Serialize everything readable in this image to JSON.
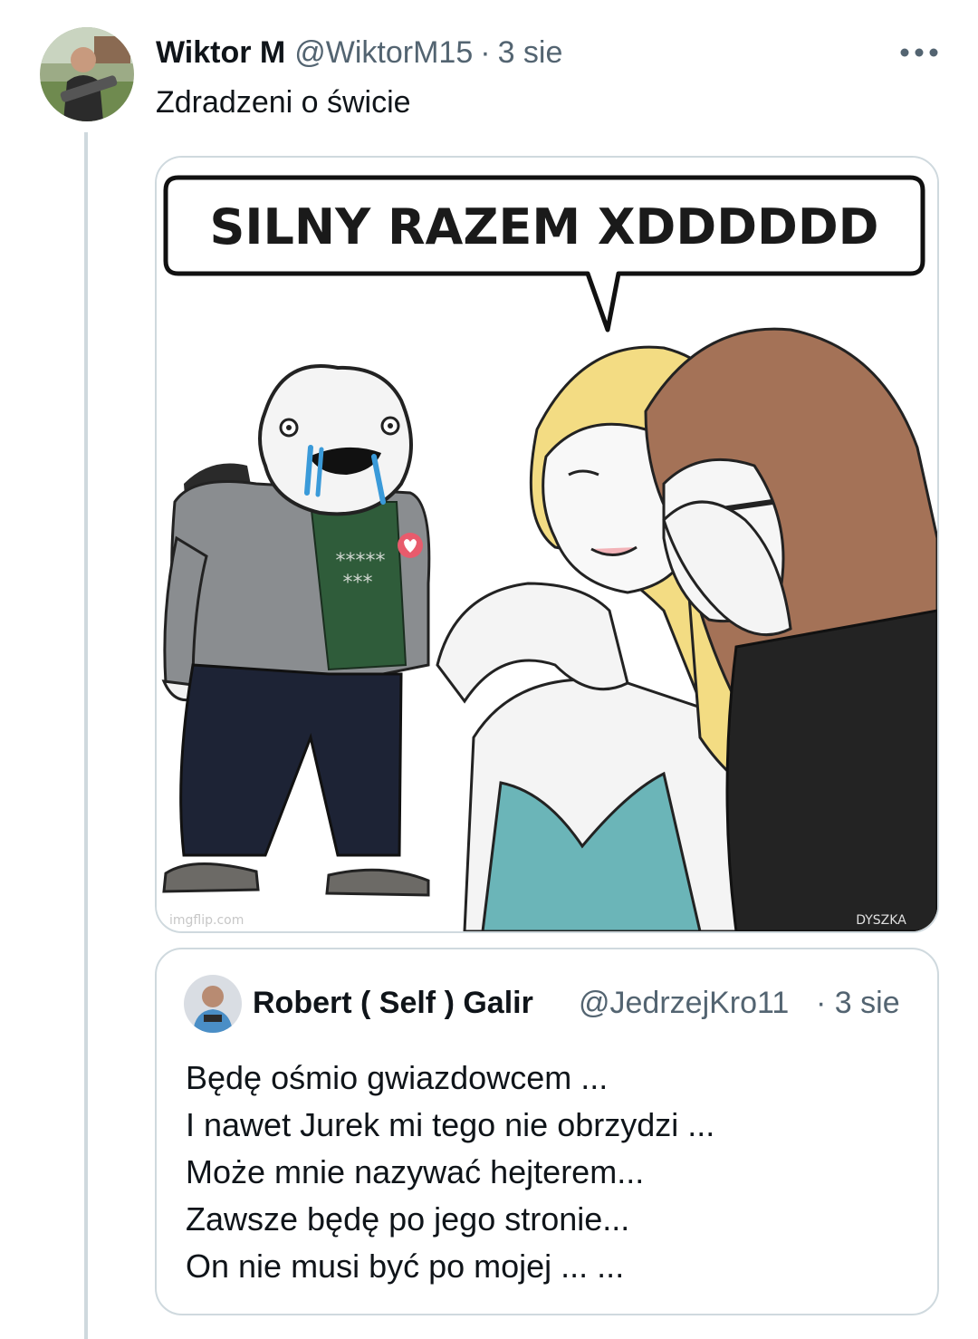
{
  "tweet": {
    "display_name": "Wiktor M",
    "handle": "@WiktorM15",
    "separator": "·",
    "date": "3 sie",
    "more_icon": "more-horizontal-icon",
    "text": "Zdradzeni o świcie"
  },
  "meme": {
    "caption": "SILNY RAZEM XDDDDDD",
    "shirt_stars_top": "*****",
    "shirt_stars_bottom": "***",
    "watermark": "DYSZKA",
    "watermark_left": "imgflip.com",
    "colors": {
      "blonde_hair": "#f3dc83",
      "brown_hair": "#a47257",
      "dress": "#6bb5b8",
      "jacket": "#8a8d90",
      "shirt": "#2f5c3a",
      "pants": "#1d2335",
      "tears": "#3a9ad9"
    }
  },
  "quote": {
    "display_name": "Robert ( Self ) Galir",
    "handle": "@JedrzejKro11",
    "separator": "·",
    "date": "3 sie",
    "lines": [
      "Będę ośmio gwiazdowcem ...",
      "I nawet Jurek mi tego nie obrzydzi ...",
      "Może mnie nazywać hejterem...",
      "Zawsze będę po jego stronie...",
      "On nie musi być po mojej ... ..."
    ]
  },
  "colors": {
    "primary_text": "#0f1419",
    "secondary_text": "#536471",
    "border": "#cfd9de"
  }
}
